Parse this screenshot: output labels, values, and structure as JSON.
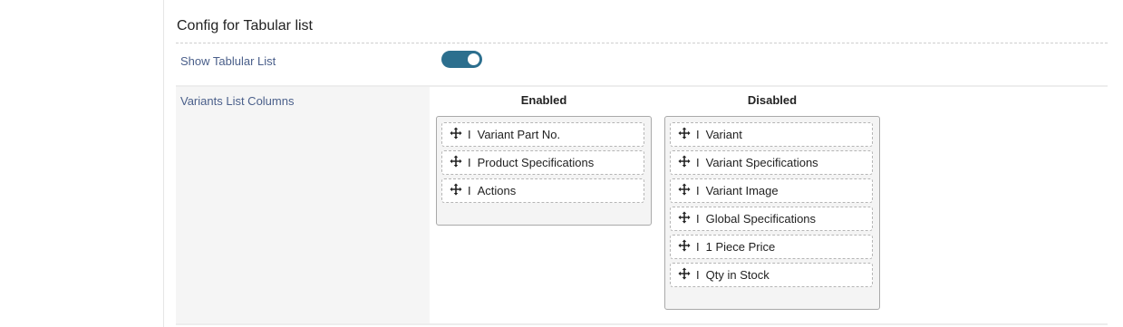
{
  "config": {
    "title": "Config for Tabular list",
    "show_tabular_label": "Show Tablular List",
    "show_tabular_on": true,
    "variants_label": "Variants List Columns",
    "accent_color": "#2c6f8e"
  },
  "enabled": {
    "heading": "Enabled",
    "items": [
      {
        "label": "Variant Part No.",
        "icon": "drag-move-icon"
      },
      {
        "label": "Product Specifications",
        "icon": "drag-move-icon"
      },
      {
        "label": "Actions",
        "icon": "drag-move-icon"
      }
    ]
  },
  "disabled": {
    "heading": "Disabled",
    "items": [
      {
        "label": "Variant",
        "icon": "drag-move-icon"
      },
      {
        "label": "Variant Specifications",
        "icon": "drag-move-icon"
      },
      {
        "label": "Variant Image",
        "icon": "drag-move-icon"
      },
      {
        "label": "Global Specifications",
        "icon": "drag-move-icon"
      },
      {
        "label": "1 Piece Price",
        "icon": "drag-move-icon"
      },
      {
        "label": "Qty in Stock",
        "icon": "drag-move-icon"
      }
    ]
  },
  "separator_glyph": "I"
}
